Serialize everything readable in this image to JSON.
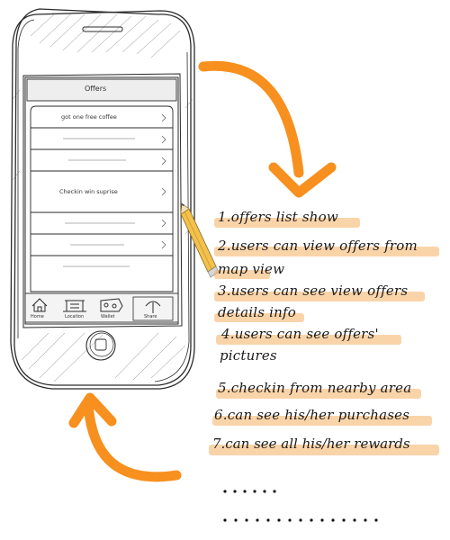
{
  "phone": {
    "nav_title": "Offers",
    "offer_rows": [
      "got one free coffee",
      "",
      "",
      "",
      "Checkin win suprise",
      "",
      "",
      ""
    ],
    "tabs": [
      "Home",
      "Location",
      "Wallet",
      "Share"
    ]
  },
  "notes": [
    "1.offers list show",
    "2.users can view offers from",
    "map view",
    "3.users can see view offers",
    "details info",
    "4.users can see offers'",
    "pictures",
    "5.checkin from nearby area",
    "6.can see his/her purchases",
    "7.can see all his/her rewards"
  ],
  "ellipsis": [
    "......",
    "..............."
  ],
  "colors": {
    "arrow": "#f7901e",
    "highlight": "#f6b062",
    "sketch": "#2b2b2b",
    "pencil": "#f2c14e"
  }
}
